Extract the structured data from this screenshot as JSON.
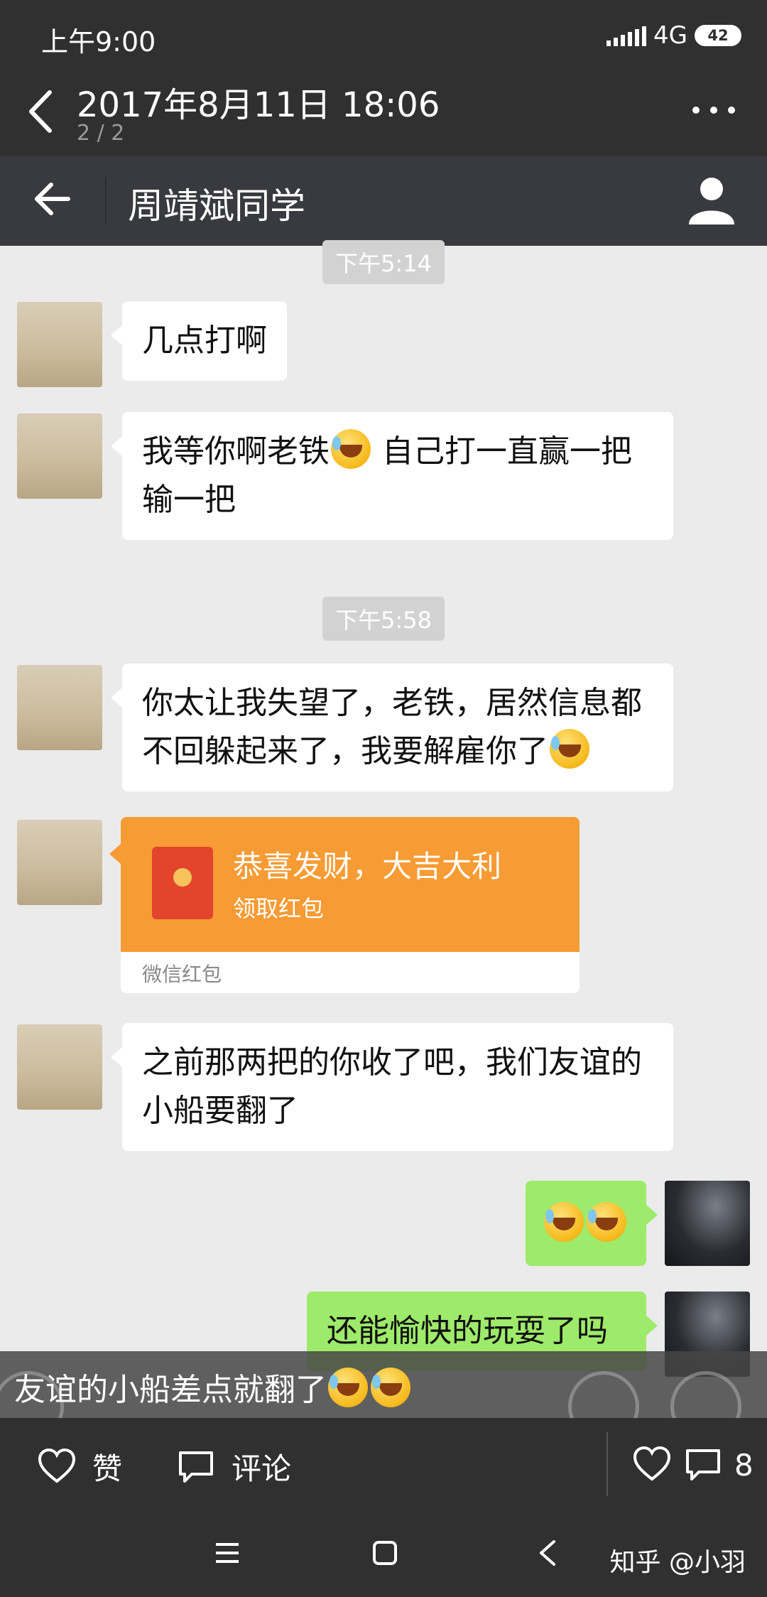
{
  "status_bar": {
    "time": "上午9:00",
    "network": "4G",
    "battery": "42"
  },
  "viewer": {
    "title": "2017年8月11日 18:06",
    "page_count": "2 / 2",
    "back_icon": "chevron-left-icon",
    "more_icon": "more-dots-icon"
  },
  "chat": {
    "title": "周靖斌同学",
    "timestamps": [
      "下午5:14",
      "下午5:58"
    ],
    "messages": [
      {
        "side": "left",
        "text": "几点打啊"
      },
      {
        "side": "left",
        "text_a": "我等你啊老铁",
        "text_b": " 自己打一直赢一把输一把"
      },
      {
        "side": "left",
        "text": "你太让我失望了，老铁，居然信息都不回躲起来了，我要解雇你了"
      },
      {
        "side": "left",
        "type": "red-packet",
        "title": "恭喜发财，大吉大利",
        "action": "领取红包",
        "label": "微信红包"
      },
      {
        "side": "left",
        "text": "之前那两把的你收了吧，我们友谊的小船要翻了"
      },
      {
        "side": "right",
        "emoji": "laugh-cry-emoji"
      },
      {
        "side": "right",
        "text": "还能愉快的玩耍了吗"
      }
    ]
  },
  "caption": "友谊的小船差点就翻了",
  "actions": {
    "like_label": "赞",
    "comment_label": "评论",
    "comment_count": "8"
  },
  "watermark": "知乎 @小羽",
  "colors": {
    "chrome": "#303030",
    "chat_bg": "#ebebeb",
    "header": "#393a3f",
    "bubble_right": "#9eea6a",
    "red_packet": "#f79b34"
  }
}
